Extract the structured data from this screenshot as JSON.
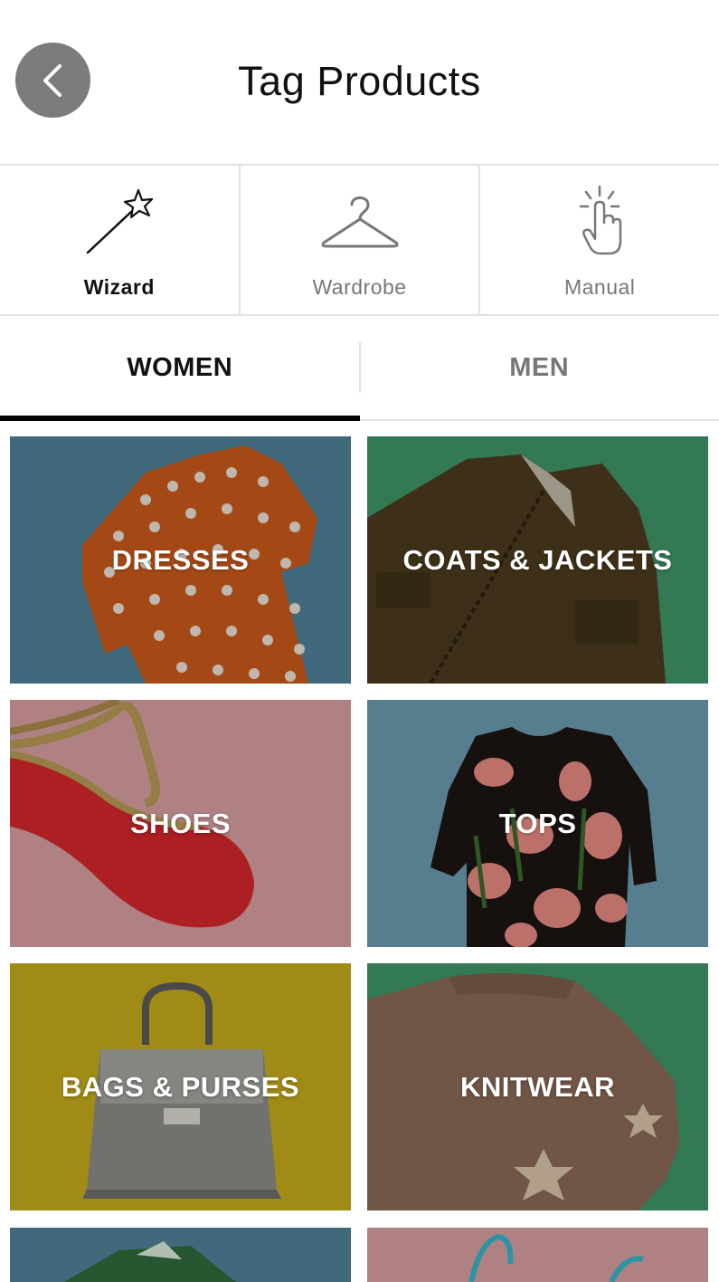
{
  "header": {
    "title": "Tag Products"
  },
  "modes": [
    {
      "label": "Wizard",
      "icon": "magic-wand-icon",
      "active": true
    },
    {
      "label": "Wardrobe",
      "icon": "hanger-icon",
      "active": false
    },
    {
      "label": "Manual",
      "icon": "tap-hand-icon",
      "active": false
    }
  ],
  "tabs": [
    {
      "label": "WOMEN",
      "active": true
    },
    {
      "label": "MEN",
      "active": false
    }
  ],
  "categories": [
    {
      "label": "DRESSES",
      "bg": "#4f8198"
    },
    {
      "label": "COATS & JACKETS",
      "bg": "#3f9467"
    },
    {
      "label": "SHOES",
      "bg": "#d79ea0"
    },
    {
      "label": "TOPS",
      "bg": "#6b9aae"
    },
    {
      "label": "BAGS & PURSES",
      "bg": "#c2aa1a"
    },
    {
      "label": "KNITWEAR",
      "bg": "#3f9467"
    }
  ],
  "partial_row_colors": [
    "#4f8198",
    "#d79ea0"
  ]
}
